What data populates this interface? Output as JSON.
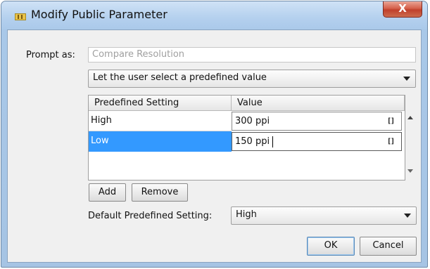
{
  "window": {
    "title": "Modify Public Parameter",
    "close_label": "X"
  },
  "prompt": {
    "label": "Prompt as:",
    "value": "Compare Resolution"
  },
  "mode_select": {
    "selected": "Let the user select a predefined value"
  },
  "table": {
    "columns": [
      "Predefined Setting",
      "Value"
    ],
    "rows": [
      {
        "setting": "High",
        "value": "300 ppi",
        "selected": false
      },
      {
        "setting": "Low",
        "value": "150 ppi",
        "selected": true
      }
    ],
    "bracket_glyph": "[]"
  },
  "buttons": {
    "add": "Add",
    "remove": "Remove",
    "ok": "OK",
    "cancel": "Cancel"
  },
  "default_setting": {
    "label": "Default Predefined Setting:",
    "selected": "High"
  },
  "colors": {
    "selection": "#3399ff",
    "titlebar": "#b4d0ee",
    "close_button": "#c0402c"
  },
  "icons": {
    "app": "parameter-icon",
    "close": "close-icon",
    "dropdown": "chevron-down-icon",
    "edit": "bracket-edit-icon"
  }
}
